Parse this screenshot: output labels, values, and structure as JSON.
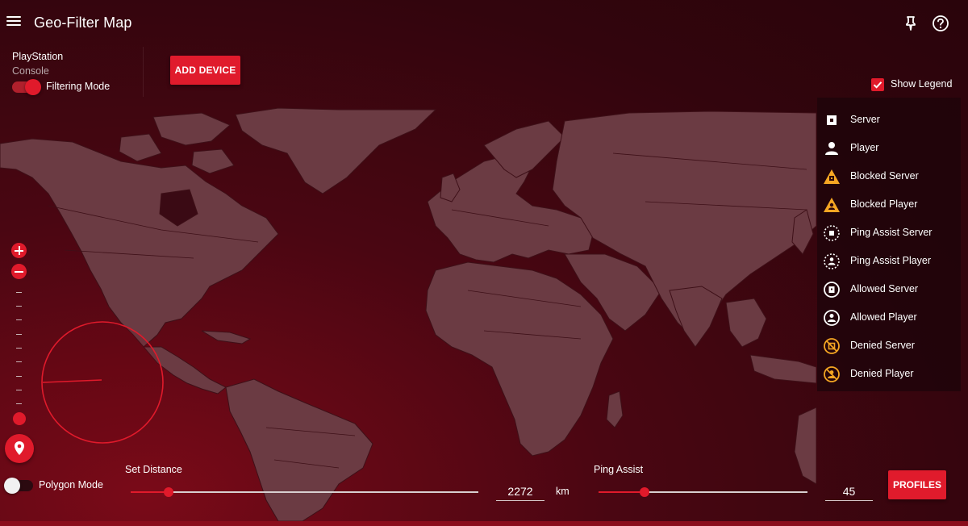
{
  "header": {
    "title": "Geo-Filter Map",
    "menu_icon": "hamburger-menu-icon",
    "pin_icon": "pin-icon",
    "help_icon": "help-circle-icon"
  },
  "device": {
    "name": "PlayStation",
    "type": "Console",
    "filtering_mode_label": "Filtering Mode",
    "filtering_mode_on": true,
    "add_device_label": "ADD DEVICE"
  },
  "legend": {
    "show_legend_label": "Show Legend",
    "show_legend_checked": true,
    "items": [
      {
        "label": "Server",
        "icon": "server-icon",
        "color": "#ffffff"
      },
      {
        "label": "Player",
        "icon": "player-icon",
        "color": "#ffffff"
      },
      {
        "label": "Blocked Server",
        "icon": "blocked-server-icon",
        "color": "#f5a623"
      },
      {
        "label": "Blocked Player",
        "icon": "blocked-player-icon",
        "color": "#f5a623"
      },
      {
        "label": "Ping Assist Server",
        "icon": "ping-assist-server-icon",
        "color": "#ffffff"
      },
      {
        "label": "Ping Assist Player",
        "icon": "ping-assist-player-icon",
        "color": "#ffffff"
      },
      {
        "label": "Allowed Server",
        "icon": "allowed-server-icon",
        "color": "#ffffff"
      },
      {
        "label": "Allowed Player",
        "icon": "allowed-player-icon",
        "color": "#ffffff"
      },
      {
        "label": "Denied Server",
        "icon": "denied-server-icon",
        "color": "#f5a623"
      },
      {
        "label": "Denied Player",
        "icon": "denied-player-icon",
        "color": "#f5a623"
      }
    ]
  },
  "map_controls": {
    "zoom_in_icon": "plus-icon",
    "zoom_out_icon": "minus-icon",
    "locate_icon": "location-pin-icon",
    "zoom_level_fraction": 0.0
  },
  "bottom": {
    "polygon_mode_label": "Polygon Mode",
    "polygon_mode_on": false,
    "set_distance_label": "Set Distance",
    "distance_value": "2272",
    "distance_unit": "km",
    "distance_fraction": 0.11,
    "ping_assist_label": "Ping Assist",
    "ping_assist_value": "45",
    "ping_assist_fraction": 0.22,
    "profiles_label": "PROFILES"
  },
  "colors": {
    "accent": "#e01a2b",
    "land": "#6b3b43",
    "background": "#3a0610",
    "warning": "#f5a623"
  }
}
